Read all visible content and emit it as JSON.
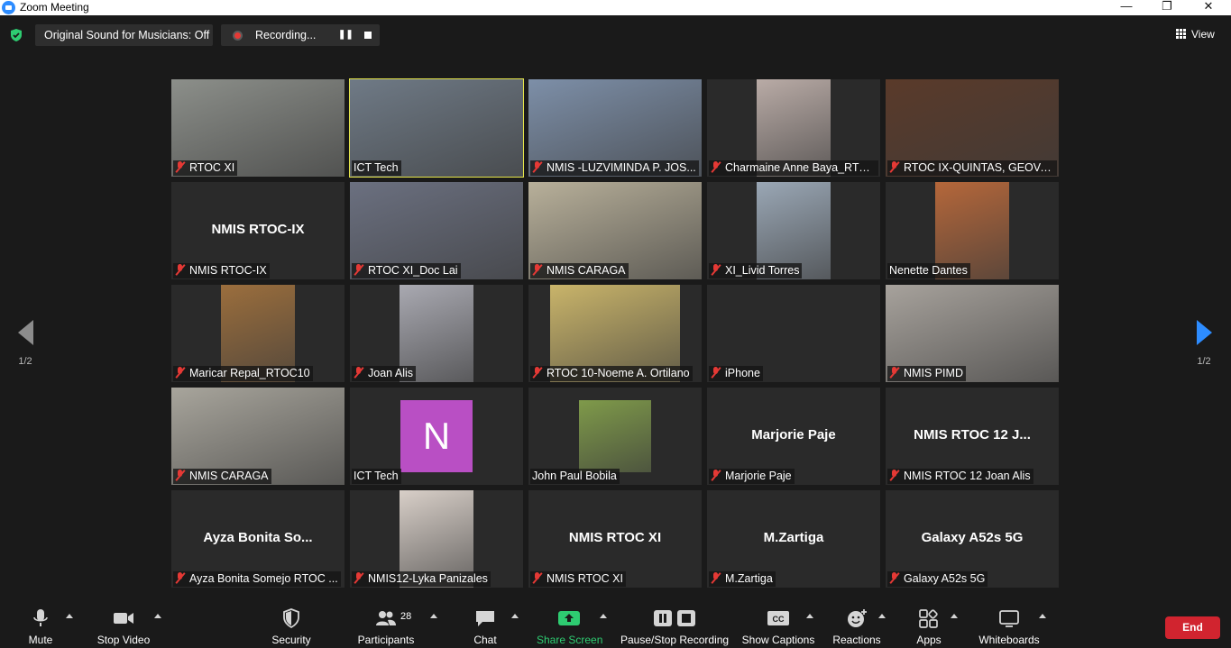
{
  "window": {
    "title": "Zoom Meeting",
    "controls": {
      "minimize": "—",
      "restore": "❐",
      "close": "✕"
    }
  },
  "topbar": {
    "original_sound": "Original Sound for Musicians: Off",
    "recording": "Recording...",
    "view": "View"
  },
  "pagination": {
    "prev": "1/2",
    "next": "1/2"
  },
  "tiles": [
    {
      "name": "RTOC XI",
      "video": true,
      "muted": true,
      "bg": "#8c8f8a"
    },
    {
      "name": "ICT Tech",
      "video": true,
      "muted": false,
      "bg": "#6f7a86",
      "active": true
    },
    {
      "name": "NMIS -LUZVIMINDA P. JOS...",
      "video": true,
      "muted": true,
      "bg": "#7d8fa8"
    },
    {
      "name": "Charmaine Anne Baya_RTO...",
      "video": true,
      "muted": true,
      "bg": "#b9aba6",
      "narrow": true
    },
    {
      "name": "RTOC IX-QUINTAS, GEOVA...",
      "video": true,
      "muted": true,
      "bg": "#5a3a2a"
    },
    {
      "name": "NMIS RTOC-IX",
      "video": false,
      "muted": true,
      "big": "NMIS RTOC-IX"
    },
    {
      "name": "RTOC XI_Doc Lai",
      "video": true,
      "muted": true,
      "bg": "#6b7080"
    },
    {
      "name": "NMIS CARAGA",
      "video": true,
      "muted": true,
      "bg": "#b8b09a"
    },
    {
      "name": "XI_Livid Torres",
      "video": true,
      "muted": true,
      "bg": "#9aa7b5",
      "narrow": true
    },
    {
      "name": "Nenette Dantes",
      "video": true,
      "muted": false,
      "bg": "#b5673a",
      "narrow": true
    },
    {
      "name": "Maricar Repal_RTOC10",
      "video": true,
      "muted": true,
      "bg": "#9b6e3d",
      "narrow": true
    },
    {
      "name": "Joan Alis",
      "video": true,
      "muted": true,
      "bg": "#a9a9b1",
      "narrow": true
    },
    {
      "name": "RTOC 10-Noeme A. Ortilano",
      "video": true,
      "muted": true,
      "bg": "#c9b46a",
      "wide": true
    },
    {
      "name": "iPhone",
      "video": false,
      "muted": true,
      "big": ""
    },
    {
      "name": "NMIS PIMD",
      "video": true,
      "muted": true,
      "bg": "#a7a29c"
    },
    {
      "name": "NMIS CARAGA",
      "video": true,
      "muted": true,
      "bg": "#a8a59c"
    },
    {
      "name": "ICT Tech",
      "video": false,
      "muted": false,
      "avatar": "N"
    },
    {
      "name": "John Paul Bobila",
      "video": true,
      "muted": false,
      "bg": "#7f9a4a",
      "small": true
    },
    {
      "name": "Marjorie Paje",
      "video": false,
      "muted": true,
      "big": "Marjorie Paje"
    },
    {
      "name": "NMIS RTOC 12 Joan Alis",
      "video": false,
      "muted": true,
      "big": "NMIS RTOC 12 J..."
    },
    {
      "name": "Ayza Bonita Somejo RTOC ...",
      "video": false,
      "muted": true,
      "big": "Ayza Bonita So..."
    },
    {
      "name": "NMIS12-Lyka Panizales",
      "video": true,
      "muted": true,
      "bg": "#d8cfc8",
      "narrow": true
    },
    {
      "name": "NMIS RTOC XI",
      "video": false,
      "muted": true,
      "big": "NMIS RTOC XI"
    },
    {
      "name": "M.Zartiga",
      "video": false,
      "muted": true,
      "big": "M.Zartiga"
    },
    {
      "name": "Galaxy A52s 5G",
      "video": false,
      "muted": true,
      "big": "Galaxy A52s 5G"
    }
  ],
  "toolbar": {
    "mute": "Mute",
    "stop_video": "Stop Video",
    "security": "Security",
    "participants": "Participants",
    "participants_count": "28",
    "chat": "Chat",
    "share_screen": "Share Screen",
    "pause_stop_recording": "Pause/Stop Recording",
    "show_captions": "Show Captions",
    "captions_badge": "CC",
    "reactions": "Reactions",
    "apps": "Apps",
    "whiteboards": "Whiteboards",
    "end": "End"
  },
  "colors": {
    "background": "#1a1a1a",
    "tile": "#2a2a2a",
    "active_speaker": "#e6e64a",
    "muted_red": "#e53935",
    "share_green": "#2ecc71",
    "end_red": "#d1242f",
    "accent_blue": "#2d8cff"
  },
  "icons": [
    "zoom-logo-icon",
    "shield-check-icon",
    "record-dot-icon",
    "pause-icon",
    "stop-icon",
    "grid-view-icon",
    "mic-icon",
    "video-camera-icon",
    "shield-icon",
    "participants-icon",
    "chat-bubble-icon",
    "share-screen-icon",
    "recording-controls-icon",
    "captions-icon",
    "emoji-plus-icon",
    "apps-icon",
    "whiteboard-icon",
    "muted-mic-icon"
  ]
}
